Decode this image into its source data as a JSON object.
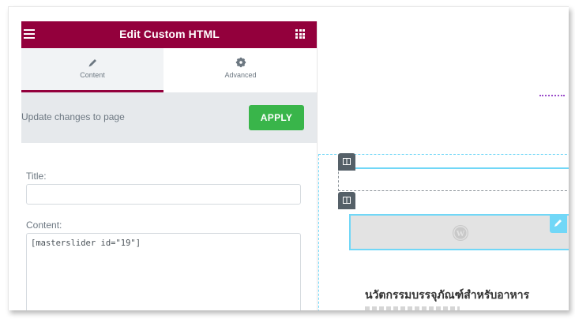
{
  "panel": {
    "title": "Edit Custom HTML",
    "tabs": [
      {
        "label": "Content",
        "icon": "pencil-icon",
        "active": true
      },
      {
        "label": "Advanced",
        "icon": "gear-icon",
        "active": false
      }
    ],
    "update_text": "Update changes to page",
    "apply_label": "APPLY",
    "fields": {
      "title_label": "Title:",
      "title_value": "",
      "content_label": "Content:",
      "content_value": "[masterslider id=\"19\"]"
    }
  },
  "preview": {
    "heading": "นวัตกรรมบรรจุภัณฑ์สำหรับอาหาร",
    "widget_icon": "wordpress-icon"
  },
  "colors": {
    "header": "#93003c",
    "apply": "#39b54a",
    "selection": "#71d7f7",
    "handle": "#556068"
  }
}
